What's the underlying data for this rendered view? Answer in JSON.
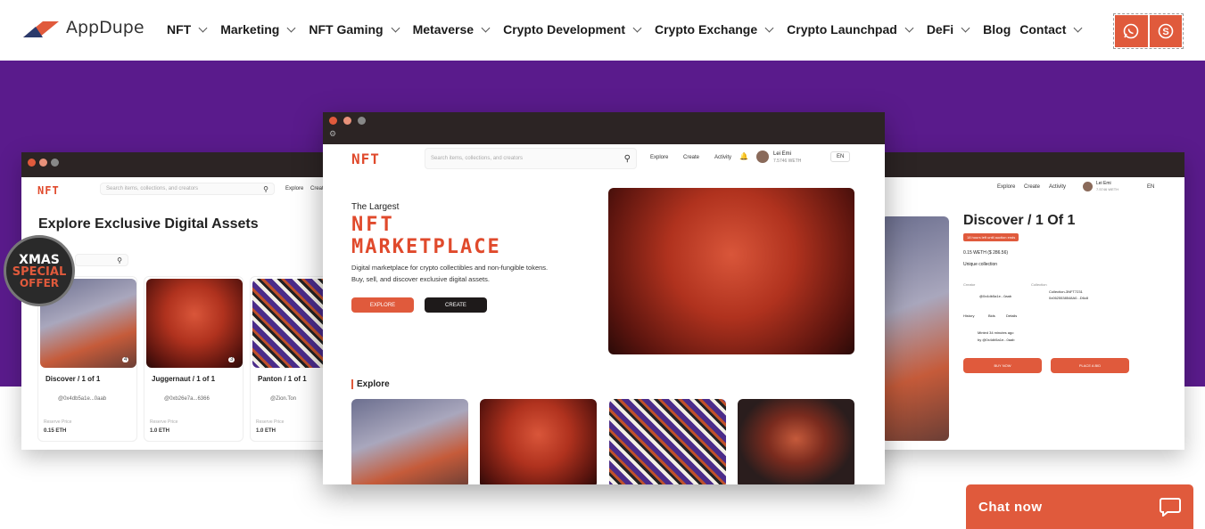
{
  "brand": {
    "name": "AppDupe"
  },
  "nav": {
    "items": [
      {
        "label": "NFT",
        "dropdown": true
      },
      {
        "label": "Marketing",
        "dropdown": true
      },
      {
        "label": "NFT Gaming",
        "dropdown": true
      },
      {
        "label": "Metaverse",
        "dropdown": true
      },
      {
        "label": "Crypto Development",
        "dropdown": true
      },
      {
        "label": "Crypto Exchange",
        "dropdown": true
      },
      {
        "label": "Crypto Launchpad",
        "dropdown": true
      },
      {
        "label": "DeFi",
        "dropdown": true
      },
      {
        "label": "Blog",
        "dropdown": false
      },
      {
        "label": "Contact",
        "dropdown": true
      }
    ]
  },
  "social": {
    "whatsapp_icon": "whatsapp-icon",
    "skype_icon": "skype-icon"
  },
  "colors": {
    "accent": "#e05a3c",
    "hero": "#5a1b8c",
    "dark": "#2c2424"
  },
  "mockup_left": {
    "logo": "NFT",
    "search_placeholder": "Search items, collections, and creators",
    "nav": [
      "Explore",
      "Create"
    ],
    "title": "Explore Exclusive Digital Assets",
    "cards": [
      {
        "title": "Discover / 1 of 1",
        "owner": "@0x4db5a1e...0aab",
        "price_label": "Reserve Price",
        "price": "0.15 ETH",
        "likes": "4"
      },
      {
        "title": "Juggernaut / 1 of 1",
        "owner": "@0xb26e7a...6366",
        "price_label": "Reserve Price",
        "price": "1.0 ETH",
        "likes": "3"
      },
      {
        "title": "Panton / 1 of 1",
        "owner": "@Zion.Ton",
        "price_label": "Reserve Price",
        "price": "1.0 ETH"
      }
    ]
  },
  "mockup_center": {
    "logo": "NFT",
    "search_placeholder": "Search items, collections, and creators",
    "nav": [
      "Explore",
      "Create",
      "Activity"
    ],
    "user_name": "Lei Emi",
    "user_balance": "7.5746 WETH",
    "lang": "EN",
    "hero_small": "The Largest",
    "hero_line1": "NFT",
    "hero_line2": "MARKETPLACE",
    "hero_desc1": "Digital marketplace for crypto collectibles and non-fungible tokens.",
    "hero_desc2": "Buy, sell, and discover exclusive digital assets.",
    "btn_explore": "EXPLORE",
    "btn_create": "CREATE",
    "section_title": "Explore"
  },
  "mockup_right": {
    "nav": [
      "Explore",
      "Create",
      "Activity"
    ],
    "user_name": "Lei Emi",
    "user_balance": "7.5746 WETH",
    "lang": "EN",
    "title": "Discover / 1 Of 1",
    "badge": "18 hours left until auction ends",
    "price": "0.15 WETH ($ 286.56)",
    "subtitle": "Unique collection",
    "creator_label": "Creator",
    "creator": "@0x4db5a1e...0aab",
    "collection_label": "Collection",
    "collection": "Collection-3NFT7231",
    "collection_addr": "0x0625538548A0...D6c8",
    "tabs": [
      "History",
      "Bids",
      "Details"
    ],
    "history_text": "Minted 34 minutes ago",
    "history_by": "by @0x4db5a1e...0aab",
    "btn_buy": "BUY NOW",
    "btn_bid": "PLACE A BID"
  },
  "promo": {
    "line1": "XMAS",
    "line2": "SPECIAL",
    "line3": "OFFER"
  },
  "chat": {
    "label": "Chat now",
    "icon": "chat-bubble-icon"
  }
}
